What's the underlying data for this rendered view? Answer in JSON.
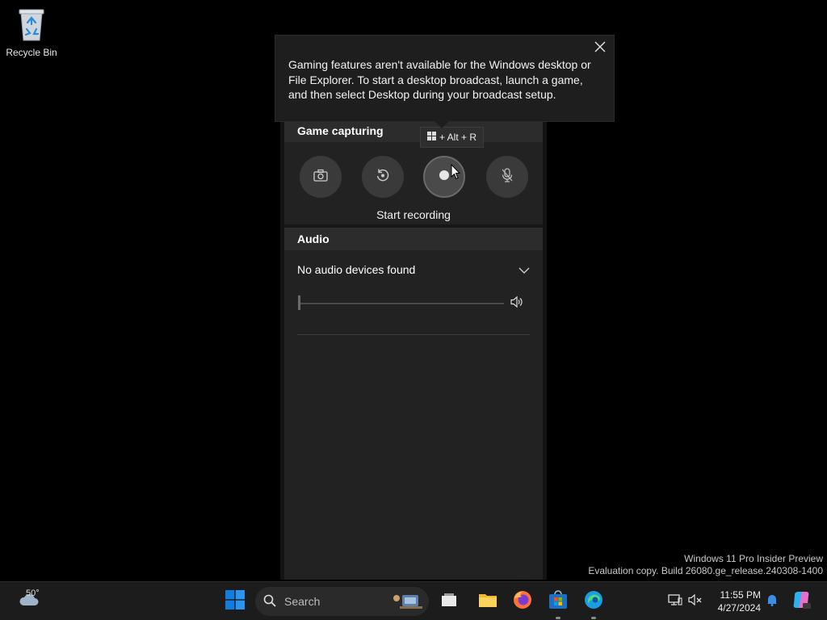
{
  "desktop": {
    "recycle_bin_label": "Recycle Bin",
    "watermark_line1": "Windows 11 Pro Insider Preview",
    "watermark_line2": "Evaluation copy. Build 26080.ge_release.240308-1400"
  },
  "popup": {
    "message": "Gaming features aren't available for the Windows desktop or File Explorer. To start a desktop broadcast, launch a game, and then select Desktop during your broadcast setup."
  },
  "capture": {
    "section_title": "Game capturing",
    "tooltip": "+ Alt + R",
    "caption": "Start recording",
    "buttons": [
      {
        "name": "screenshot",
        "icon": "camera-icon"
      },
      {
        "name": "record-last",
        "icon": "replay-icon"
      },
      {
        "name": "start-recording",
        "icon": "record-icon"
      },
      {
        "name": "microphone",
        "icon": "mic-off-icon"
      }
    ]
  },
  "audio": {
    "section_title": "Audio",
    "device_selected": "No audio devices found",
    "volume_level": 0
  },
  "taskbar": {
    "weather_temp": "50°",
    "search_placeholder": "Search",
    "time": "11:55 PM",
    "date": "4/27/2024",
    "accent": "#0078d4"
  }
}
